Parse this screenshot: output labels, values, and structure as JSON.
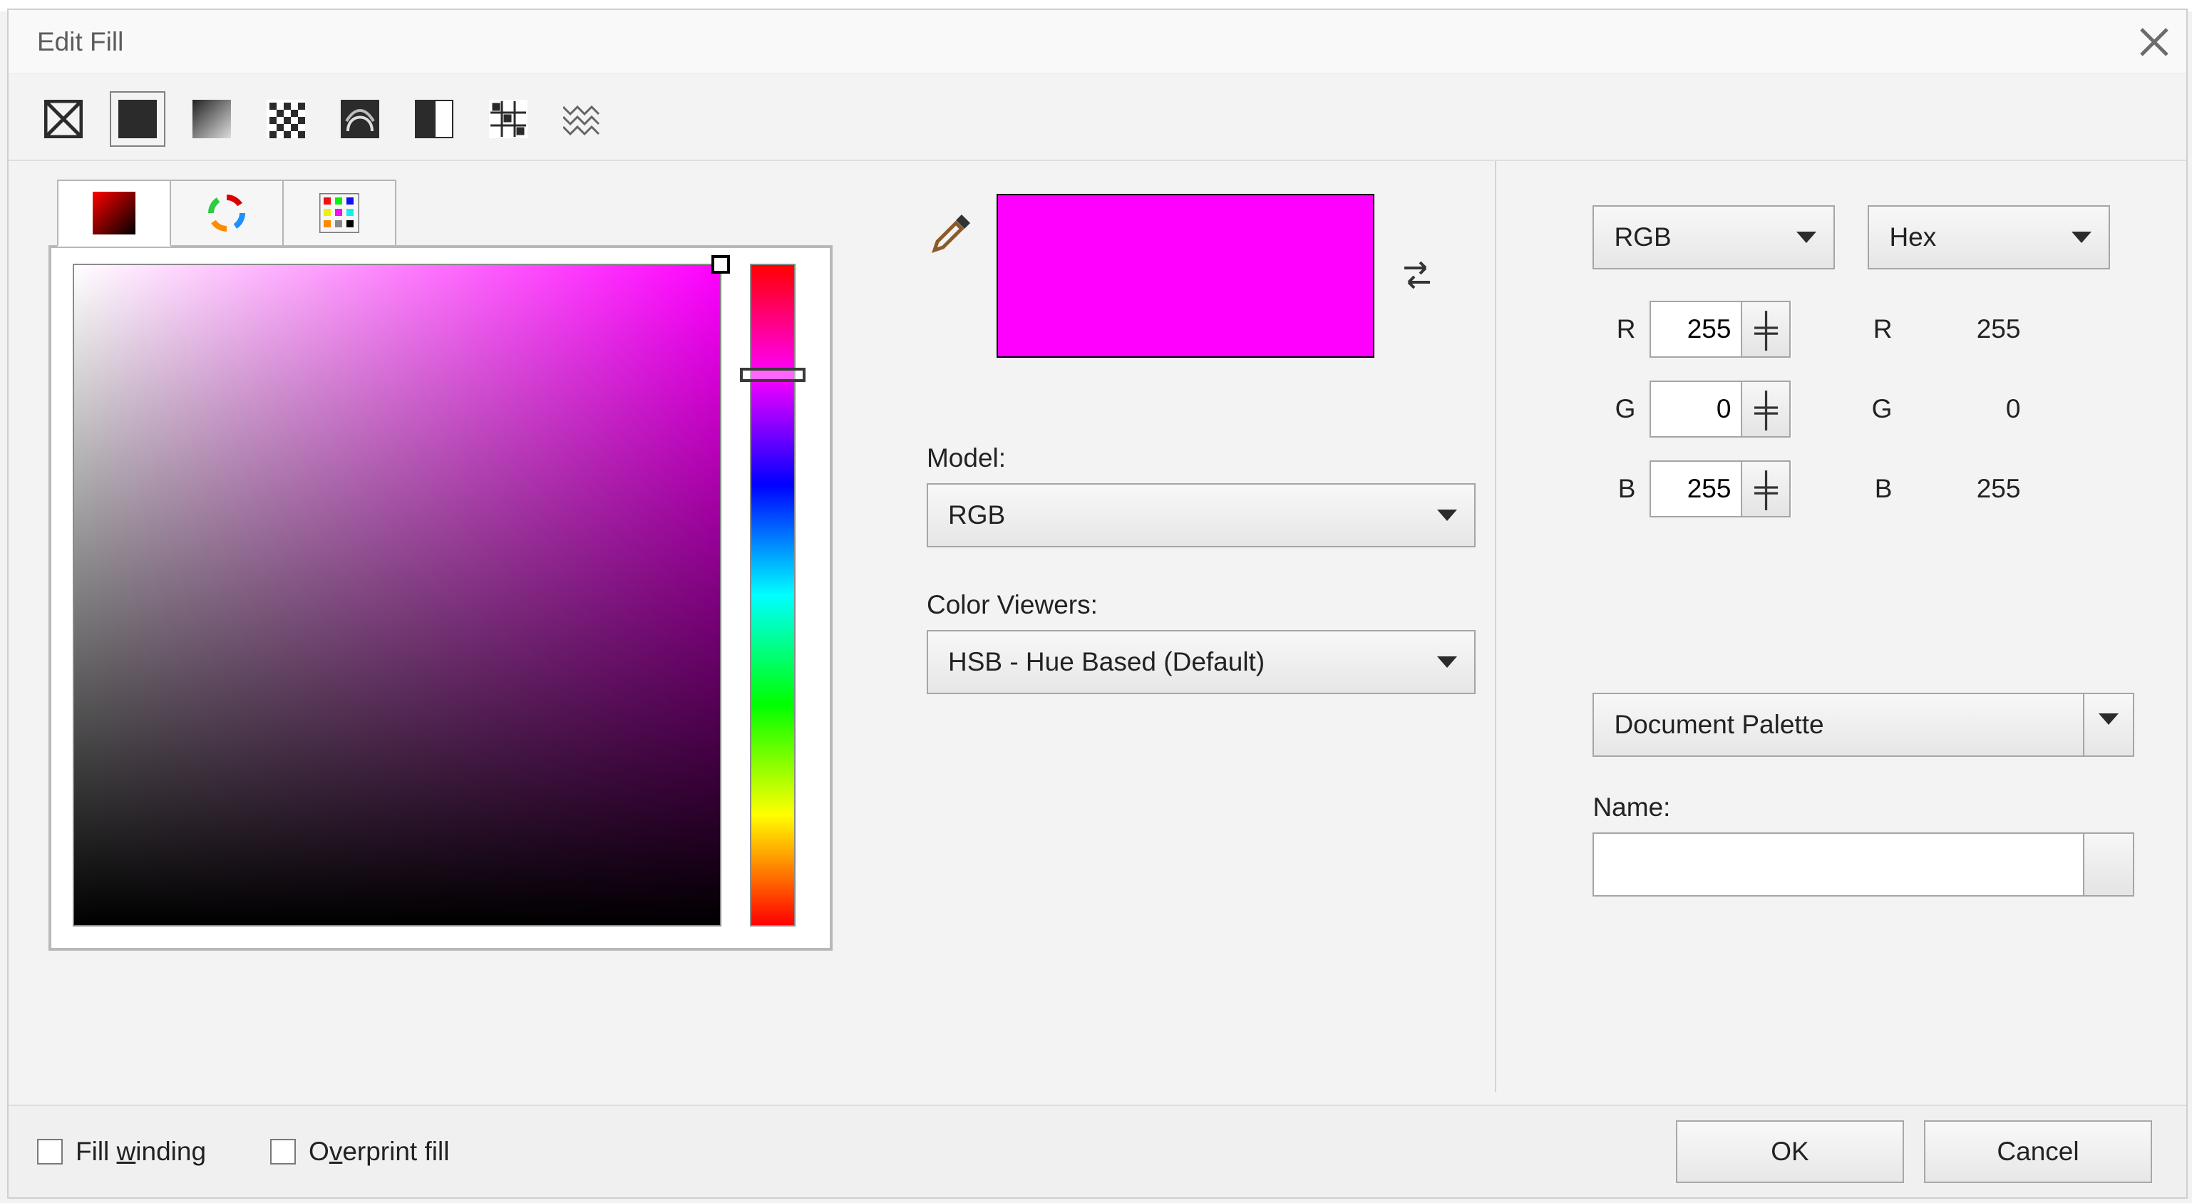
{
  "dialog": {
    "title": "Edit Fill"
  },
  "fillTypes": {
    "names": [
      "no-fill-icon",
      "uniform-fill-icon",
      "fountain-fill-icon",
      "vector-pattern-icon",
      "bitmap-pattern-icon",
      "two-color-icon",
      "texture-fill-icon",
      "postscript-fill-icon"
    ],
    "selectedIndex": 1
  },
  "swatch": {
    "hex": "#FF00FF"
  },
  "model": {
    "label": "Model:",
    "value": "RGB"
  },
  "colorViewers": {
    "label": "Color Viewers:",
    "value": "HSB - Hue Based (Default)"
  },
  "numericSelector": {
    "value": "RGB"
  },
  "hexSelector": {
    "value": "Hex"
  },
  "channels": {
    "r": {
      "label": "R",
      "value": "255",
      "hexValue": "255"
    },
    "g": {
      "label": "G",
      "value": "0",
      "hexValue": "0"
    },
    "b": {
      "label": "B",
      "value": "255",
      "hexValue": "255"
    }
  },
  "palette": {
    "value": "Document Palette",
    "nameLabel": "Name:",
    "nameValue": ""
  },
  "footer": {
    "fillWinding_pre": "Fill ",
    "fillWinding_u": "w",
    "fillWinding_post": "inding",
    "overprint_pre": "O",
    "overprint_u": "v",
    "overprint_post": "erprint fill",
    "ok": "OK",
    "cancel": "Cancel"
  }
}
